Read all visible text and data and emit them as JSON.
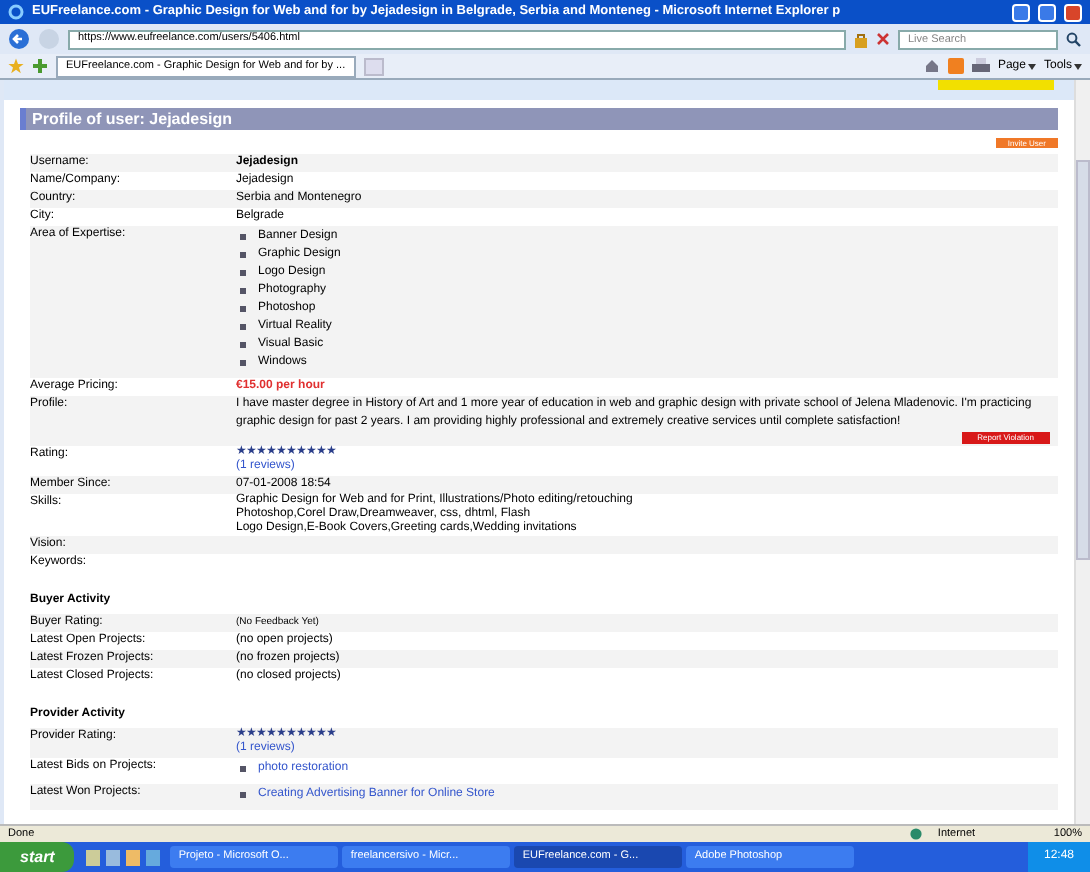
{
  "window": {
    "title": "EUFreelance.com - Graphic Design for Web and for by Jejadesign in Belgrade, Serbia and Monteneg - Microsoft Internet Explorer p"
  },
  "address_bar": {
    "url": "https://www.eufreelance.com/users/5406.html"
  },
  "search": {
    "placeholder": "Live Search"
  },
  "tabs": [
    {
      "label": "EUFreelance.com - Graphic Design for Web and for by ...",
      "selected": true
    }
  ],
  "toolbar": [
    "Page",
    "Tools"
  ],
  "profile": {
    "heading": "Profile of user: Jejadesign",
    "invite_button": "Invite User",
    "rows": [
      {
        "kind": "bold",
        "label": "Username:",
        "value": "Jejadesign"
      },
      {
        "kind": "text",
        "label": "Name/Company:",
        "value": "Jejadesign"
      },
      {
        "kind": "text",
        "label": "Country:",
        "value": "Serbia and Montenegro"
      },
      {
        "kind": "text",
        "label": "City:",
        "value": "Belgrade"
      },
      {
        "kind": "list",
        "label": "Area of Expertise:",
        "items": [
          "Banner Design",
          "Graphic Design",
          "Logo Design",
          "Photography",
          "Photoshop",
          "Virtual Reality",
          "Visual Basic",
          "Windows"
        ]
      },
      {
        "kind": "price",
        "label": "Average Pricing:",
        "value": "€15.00 per hour"
      },
      {
        "kind": "para",
        "label": "Profile:",
        "value": "I have master degree in History of Art and 1 more year of education in web and graphic design with private school of Jelena Mladenovic. I'm practicing graphic design for past 2 years. I am providing highly professional and extremely creative services until complete satisfaction!",
        "button": "Report Violation"
      },
      {
        "kind": "rating",
        "label": "Rating:",
        "stars": 10,
        "link": "(1 reviews)"
      },
      {
        "kind": "text",
        "label": "Member Since:",
        "value": "07-01-2008 18:54"
      },
      {
        "kind": "lines",
        "label": "Skills:",
        "lines": [
          "Graphic Design for Web and for Print, Illustrations/Photo editing/retouching",
          "Photoshop,Corel Draw,Dreamweaver, css, dhtml, Flash",
          "Logo Design,E-Book Covers,Greeting cards,Wedding invitations"
        ]
      },
      {
        "kind": "empty",
        "label": "Vision:"
      },
      {
        "kind": "empty",
        "label": "Keywords:"
      },
      {
        "kind": "section",
        "label": "Buyer Activity"
      },
      {
        "kind": "small",
        "label": "Buyer Rating:",
        "value": "(No Feedback Yet)"
      },
      {
        "kind": "text",
        "label": "Latest Open Projects:",
        "value": "(no open projects)"
      },
      {
        "kind": "text",
        "label": "Latest Frozen Projects:",
        "value": "(no frozen projects)"
      },
      {
        "kind": "text",
        "label": "Latest Closed Projects:",
        "value": "(no closed projects)"
      },
      {
        "kind": "section",
        "label": "Provider Activity"
      },
      {
        "kind": "rating",
        "label": "Provider Rating:",
        "stars": 10,
        "link": "(1 reviews)"
      },
      {
        "kind": "links",
        "label": "Latest Bids on Projects:",
        "items": [
          "photo restoration"
        ]
      },
      {
        "kind": "links",
        "label": "Latest Won Projects:",
        "items": [
          "Creating Advertising Banner for Online Store"
        ]
      }
    ]
  },
  "status_bar": {
    "text": "Done",
    "zone": "Internet",
    "zoom": "100%"
  },
  "taskbar": {
    "start": "start",
    "tasks": [
      {
        "label": "Projeto - Microsoft O...",
        "selected": false
      },
      {
        "label": "freelancersivo - Micr...",
        "selected": false
      },
      {
        "label": "EUFreelance.com - G...",
        "selected": true
      },
      {
        "label": "Adobe Photoshop",
        "selected": false
      }
    ],
    "clock": "12:48"
  }
}
